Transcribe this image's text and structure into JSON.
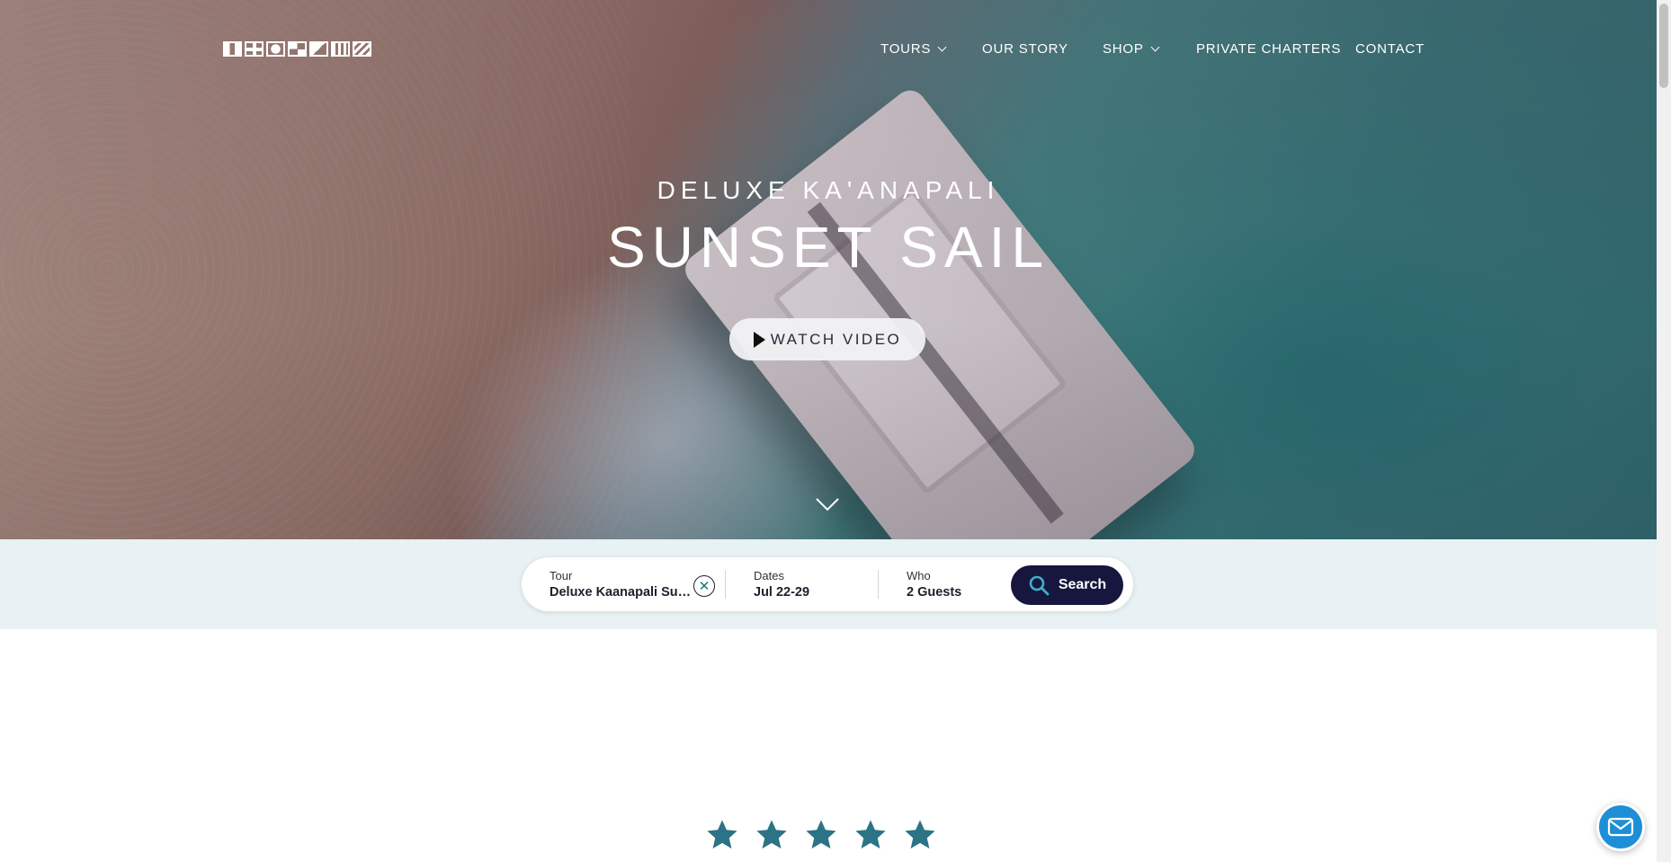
{
  "header": {
    "logo_alt": "signal flags logo",
    "nav": [
      {
        "label": "TOURS",
        "dropdown": true
      },
      {
        "label": "OUR STORY",
        "dropdown": false
      },
      {
        "label": "SHOP",
        "dropdown": true
      },
      {
        "label": "PRIVATE CHARTERS",
        "dropdown": false
      },
      {
        "label": "CONTACT",
        "dropdown": false
      }
    ]
  },
  "hero": {
    "kicker": "DELUXE KA'ANAPALI",
    "title": "SUNSET SAIL",
    "watch_video_label": "WATCH VIDEO"
  },
  "search": {
    "tour_label": "Tour",
    "tour_value": "Deluxe Kaanapali Sun...",
    "dates_label": "Dates",
    "dates_value": "Jul 22-29",
    "who_label": "Who",
    "who_value": "2 Guests",
    "button_label": "Search",
    "button_color": "#16163f"
  },
  "rating": {
    "stars": 5,
    "star_color": "#2c7386"
  },
  "colors": {
    "accent": "#1e8fd6",
    "strip_bg": "#e8f1f3"
  }
}
